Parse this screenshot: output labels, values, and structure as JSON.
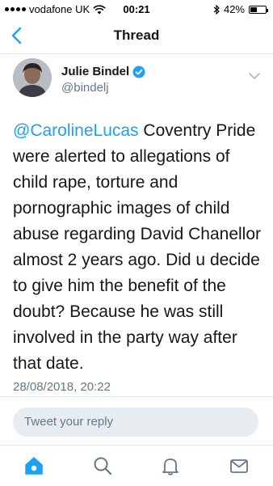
{
  "status_bar": {
    "carrier": "vodafone UK",
    "time": "00:21",
    "battery": "42%",
    "battery_level": 0.42
  },
  "header": {
    "title": "Thread",
    "back_icon": "chevron-left-icon"
  },
  "tweet": {
    "author_name": "Julie Bindel",
    "author_handle": "@bindelj",
    "mention": "@CarolineLucas",
    "text": "Coventry Pride were alerted to allegations of child rape, torture and pornographic images of child abuse regarding David Chanellor almost 2 years ago. Did u decide to give him the benefit of the doubt? Because he was still involved in the party way after that date.",
    "timestamp": "28/08/2018, 20:22"
  },
  "reply": {
    "placeholder": "Tweet your reply"
  },
  "tab_bar": {
    "items": [
      "home-icon",
      "search-icon",
      "notifications-icon",
      "messages-icon"
    ],
    "active": "home-icon"
  },
  "colors": {
    "accent": "#1da1f2",
    "secondary_text": "#657786",
    "divider": "#e1e8ed"
  }
}
